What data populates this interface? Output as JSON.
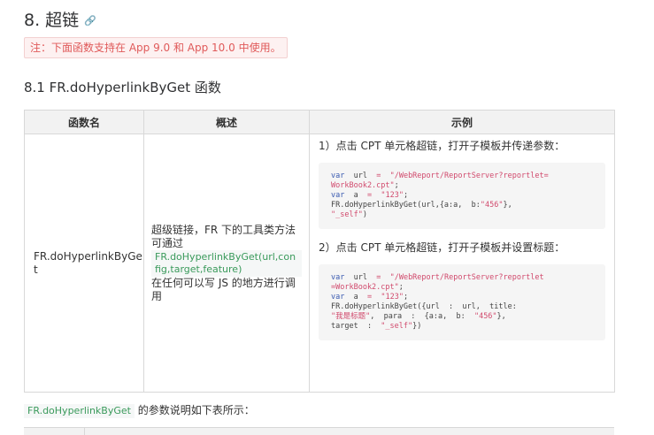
{
  "section": {
    "title": "8. 超链",
    "link_icon": "🔗",
    "note": "注：下面函数支持在 App 9.0 和 App 10.0 中使用。",
    "subtitle": "8.1 FR.doHyperlinkByGet 函数"
  },
  "table": {
    "headers": [
      "函数名",
      "概述",
      "示例"
    ],
    "function_name": "FR.doHyperlinkByGet",
    "summary_1": "超级链接，FR 下的工具类方法",
    "summary_2": "可通过",
    "summary_code": "FR.doHyperlinkByGet(url,config,target,feature)",
    "summary_3": "在任何可以写 JS 的地方进行调用",
    "example1_title": "1）点击 CPT 单元格超链，打开子模板并传递参数：",
    "example1_code": {
      "l1_kw": "var",
      "l1_a": "url",
      "l1_eq": "=",
      "l1_str": "\"/WebReport/ReportServer?reportlet=",
      "l2_str": "WorkBook2.cpt\"",
      "l2_end": ";",
      "l3_kw": "var",
      "l3_a": "a",
      "l3_eq": "=",
      "l3_str": "\"123\"",
      "l3_end": ";",
      "l4_a": "FR.doHyperlinkByGet(url,{a:a,  b:",
      "l4_str": "\"456\"",
      "l4_end": "},",
      "l5_str": "\"_self\"",
      "l5_end": ")"
    },
    "example2_title": "2）点击 CPT 单元格超链，打开子模板并设置标题：",
    "example2_code": {
      "l1_kw": "var",
      "l1_a": "url",
      "l1_eq": "=",
      "l1_str": "\"/WebReport/ReportServer?reportlet",
      "l2_str": "=WorkBook2.cpt\"",
      "l2_end": ";",
      "l3_kw": "var",
      "l3_a": "a",
      "l3_eq": "=",
      "l3_str": "\"123\"",
      "l3_end": ";",
      "l4_a": "FR.doHyperlinkByGet({url  :  url,  title:",
      "l5_str": "\"我是标题\"",
      "l5_mid": ",  para  :  {a:a,  b:  ",
      "l5_str2": "\"456\"",
      "l5_end": "},",
      "l6_a": "target  :  ",
      "l6_str": "\"_self\"",
      "l6_end": "})"
    }
  },
  "params_note": {
    "code": "FR.doHyperlinkByGet",
    "text": " 的参数说明如下表所示："
  }
}
